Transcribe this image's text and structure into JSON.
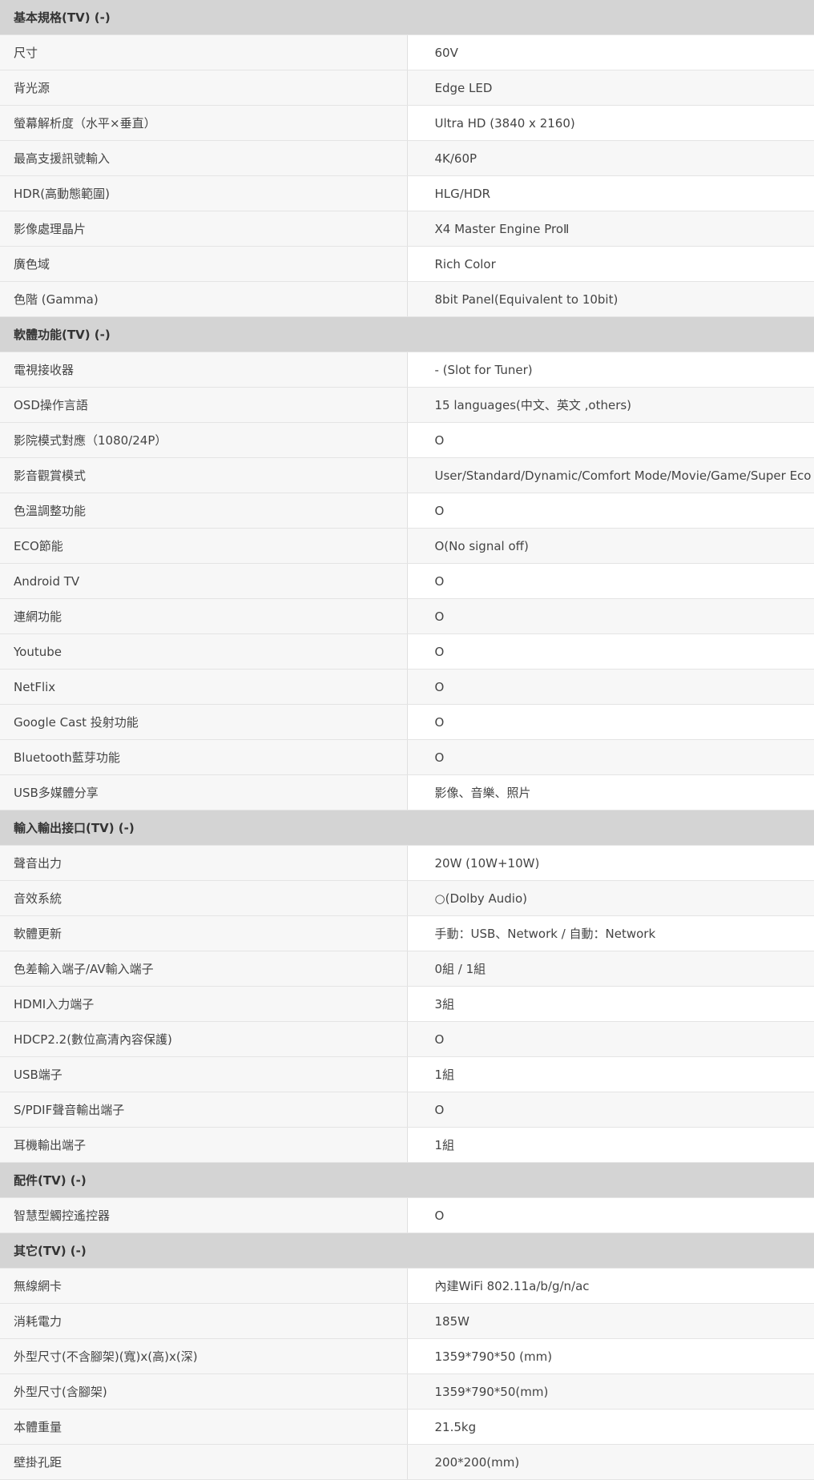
{
  "sections": [
    {
      "title": "基本規格(TV) (-)",
      "rows": [
        {
          "label": "尺寸",
          "value": "60V"
        },
        {
          "label": "背光源",
          "value": "Edge LED"
        },
        {
          "label": "螢幕解析度（水平×垂直）",
          "value": "Ultra HD (3840 x 2160)"
        },
        {
          "label": "最高支援訊號輸入",
          "value": "4K/60P"
        },
        {
          "label": "HDR(高動態範圍)",
          "value": "HLG/HDR"
        },
        {
          "label": "影像處理晶片",
          "value": "X4 Master Engine ProⅡ"
        },
        {
          "label": "廣色域",
          "value": "Rich Color"
        },
        {
          "label": "色階 (Gamma)",
          "value": "8bit Panel(Equivalent to 10bit)"
        }
      ]
    },
    {
      "title": "軟體功能(TV) (-)",
      "rows": [
        {
          "label": "電視接收器",
          "value": "- (Slot for Tuner)"
        },
        {
          "label": "OSD操作言語",
          "value": "15 languages(中文、英文 ,others)"
        },
        {
          "label": "影院模式對應（1080/24P）",
          "value": "O"
        },
        {
          "label": "影音觀賞模式",
          "value": "User/Standard/Dynamic/Comfort Mode/Movie/Game/Super Eco"
        },
        {
          "label": "色溫調整功能",
          "value": "O"
        },
        {
          "label": "ECO節能",
          "value": "O(No signal off)"
        },
        {
          "label": "Android TV",
          "value": "O"
        },
        {
          "label": "連網功能",
          "value": "O"
        },
        {
          "label": "Youtube",
          "value": "O"
        },
        {
          "label": "NetFlix",
          "value": "O"
        },
        {
          "label": "Google Cast 投射功能",
          "value": "O"
        },
        {
          "label": "Bluetooth藍芽功能",
          "value": "O"
        },
        {
          "label": "USB多媒體分享",
          "value": "影像、音樂、照片"
        }
      ]
    },
    {
      "title": "輸入輸出接口(TV) (-)",
      "rows": [
        {
          "label": "聲音出力",
          "value": "20W (10W+10W)"
        },
        {
          "label": "音效系統",
          "value": "○(Dolby Audio)"
        },
        {
          "label": "軟體更新",
          "value": "手動：USB、Network / 自動：Network"
        },
        {
          "label": "色差輸入端子/AV輸入端子",
          "value": "0組 / 1組"
        },
        {
          "label": "HDMI入力端子",
          "value": "3組"
        },
        {
          "label": "HDCP2.2(數位高清內容保護)",
          "value": "O"
        },
        {
          "label": "USB端子",
          "value": "1組"
        },
        {
          "label": "S/PDIF聲音輸出端子",
          "value": "O"
        },
        {
          "label": "耳機輸出端子",
          "value": "1組"
        }
      ]
    },
    {
      "title": "配件(TV) (-)",
      "rows": [
        {
          "label": "智慧型觸控遙控器",
          "value": "O"
        }
      ]
    },
    {
      "title": "其它(TV) (-)",
      "rows": [
        {
          "label": "無線網卡",
          "value": "內建WiFi 802.11a/b/g/n/ac"
        },
        {
          "label": "消耗電力",
          "value": "185W"
        },
        {
          "label": "外型尺寸(不含腳架)(寬)x(高)x(深)",
          "value": "1359*790*50 (mm)"
        },
        {
          "label": "外型尺寸(含腳架)",
          "value": "1359*790*50(mm)"
        },
        {
          "label": "本體重量",
          "value": "21.5kg"
        },
        {
          "label": "壁掛孔距",
          "value": "200*200(mm)"
        }
      ]
    }
  ]
}
